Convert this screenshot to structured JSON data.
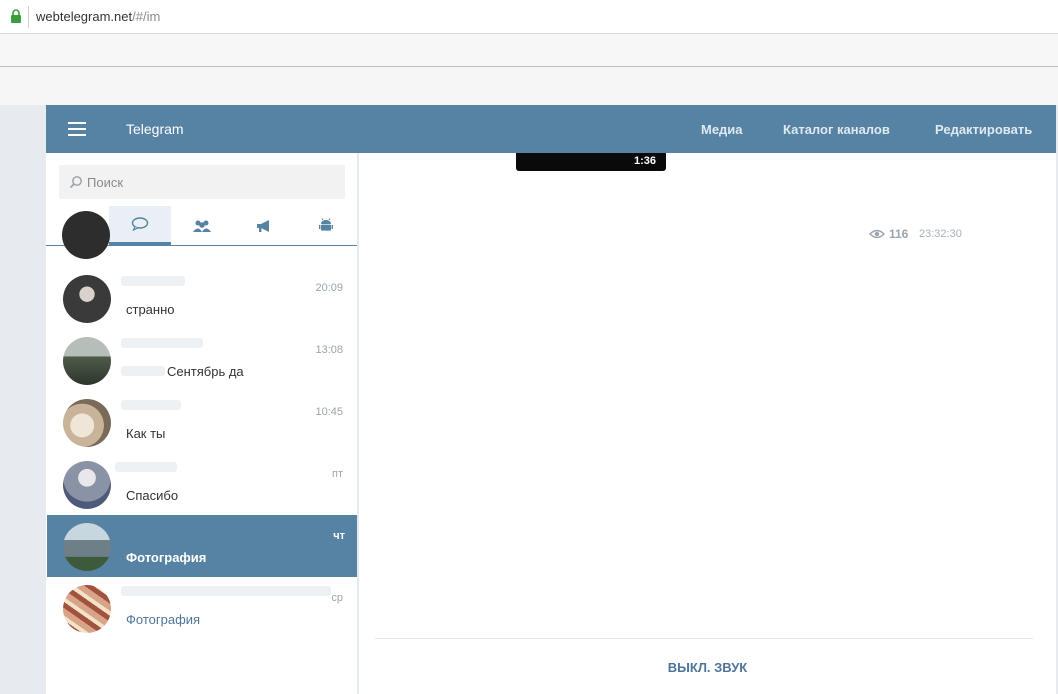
{
  "browser": {
    "url_host": "webtelegram.net",
    "url_path": "/#/im"
  },
  "header": {
    "title": "Telegram",
    "nav": [
      "Медиа",
      "Каталог каналов",
      "Редактировать"
    ]
  },
  "search": {
    "placeholder": "Поиск"
  },
  "tabs": [
    {
      "icon": "circle-dot-icon",
      "active": false
    },
    {
      "icon": "chat-bubble-icon",
      "active": true
    },
    {
      "icon": "group-icon",
      "active": false
    },
    {
      "icon": "megaphone-icon",
      "active": false
    },
    {
      "icon": "robot-icon",
      "active": false
    }
  ],
  "dialogs": [
    {
      "time": "20:09",
      "preview": "странно",
      "avatar_color": "#3a3a3a"
    },
    {
      "time": "13:08",
      "preview": "Сентябрь да",
      "avatar_color": "#6f7a6a"
    },
    {
      "time": "10:45",
      "preview": "Как ты",
      "avatar_color": "#c9b49a"
    },
    {
      "time": "пт",
      "preview": "Спасибо",
      "avatar_color": "#8a93a6"
    },
    {
      "time": "чт",
      "preview": "Фотография",
      "avatar_color": "#7b8c95",
      "selected": true
    },
    {
      "time": "ср",
      "preview": "Фотография",
      "avatar_color": "#a0523d",
      "media": true
    }
  ],
  "chat": {
    "video_duration": "1:36",
    "views": "116",
    "message_time": "23:32:30",
    "mute_label": "ВЫКЛ. ЗВУК"
  },
  "colors": {
    "header": "#5682a3",
    "selected": "#5682a3",
    "link": "#4e7599"
  }
}
